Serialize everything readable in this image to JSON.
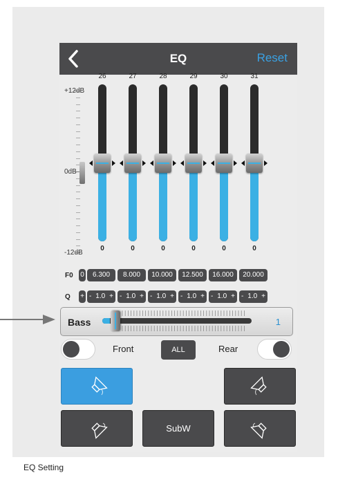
{
  "navbar": {
    "back_icon": "chevron-left-icon",
    "title": "EQ",
    "reset_label": "Reset"
  },
  "scale": {
    "top": "+12dB",
    "mid": "0dB",
    "bottom": "-12dB"
  },
  "bands": [
    {
      "number": "26",
      "value": "0",
      "level": 0.5,
      "f0": "6.300",
      "q": "1.0"
    },
    {
      "number": "27",
      "value": "0",
      "level": 0.5,
      "f0": "8.000",
      "q": "1.0"
    },
    {
      "number": "28",
      "value": "0",
      "level": 0.5,
      "f0": "10.000",
      "q": "1.0"
    },
    {
      "number": "29",
      "value": "0",
      "level": 0.5,
      "f0": "12.500",
      "q": "1.0"
    },
    {
      "number": "30",
      "value": "0",
      "level": 0.5,
      "f0": "16.000",
      "q": "1.0"
    },
    {
      "number": "31",
      "value": "0",
      "level": 0.5,
      "f0": "20.000",
      "q": "1.0"
    }
  ],
  "partial": {
    "f0": "0",
    "q_plus": "+"
  },
  "rows": {
    "f0_label": "F0",
    "q_label": "Q",
    "minus": "-",
    "plus": "+"
  },
  "bass": {
    "label": "Bass",
    "value": "1",
    "level": 0.05
  },
  "fader": {
    "front_label": "Front",
    "all_label": "ALL",
    "rear_label": "Rear"
  },
  "speakers": {
    "front_left_icon": "speaker-front-left-icon",
    "front_right_icon": "speaker-front-right-icon",
    "rear_left_icon": "speaker-rear-left-icon",
    "rear_right_icon": "speaker-rear-right-icon",
    "subw_label": "SubW"
  },
  "caption": "EQ Setting",
  "colors": {
    "accent": "#3bb0e4",
    "navbar": "#4a4a4c",
    "active": "#3b9ee0"
  }
}
